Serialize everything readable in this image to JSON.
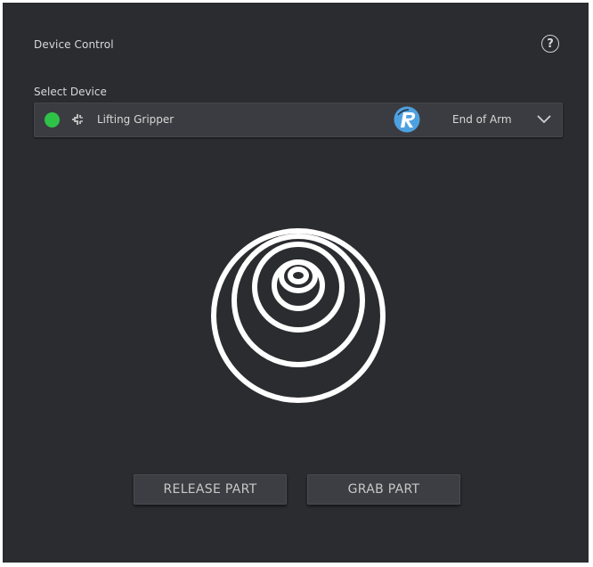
{
  "header": {
    "title": "Device Control",
    "help_icon": "question-circle-icon",
    "help_glyph": "?"
  },
  "device_select": {
    "label": "Select Device",
    "status_color": "#2fc248",
    "status_icon": "status-dot-icon",
    "device_icon": "gripper-icon",
    "device_name": "Lifting Gripper",
    "brand_icon": "robotiq-r-logo-icon",
    "mount": "End of Arm",
    "expand_icon": "chevron-down-icon"
  },
  "visual": {
    "icon": "concentric-rings-target-icon"
  },
  "actions": {
    "release_label": "RELEASE PART",
    "grab_label": "GRAB PART"
  },
  "colors": {
    "panel_bg": "#2b2c30",
    "dropdown_bg": "#3b3c41",
    "button_bg": "#3d3e43",
    "brand_blue": "#4ea1e0"
  }
}
